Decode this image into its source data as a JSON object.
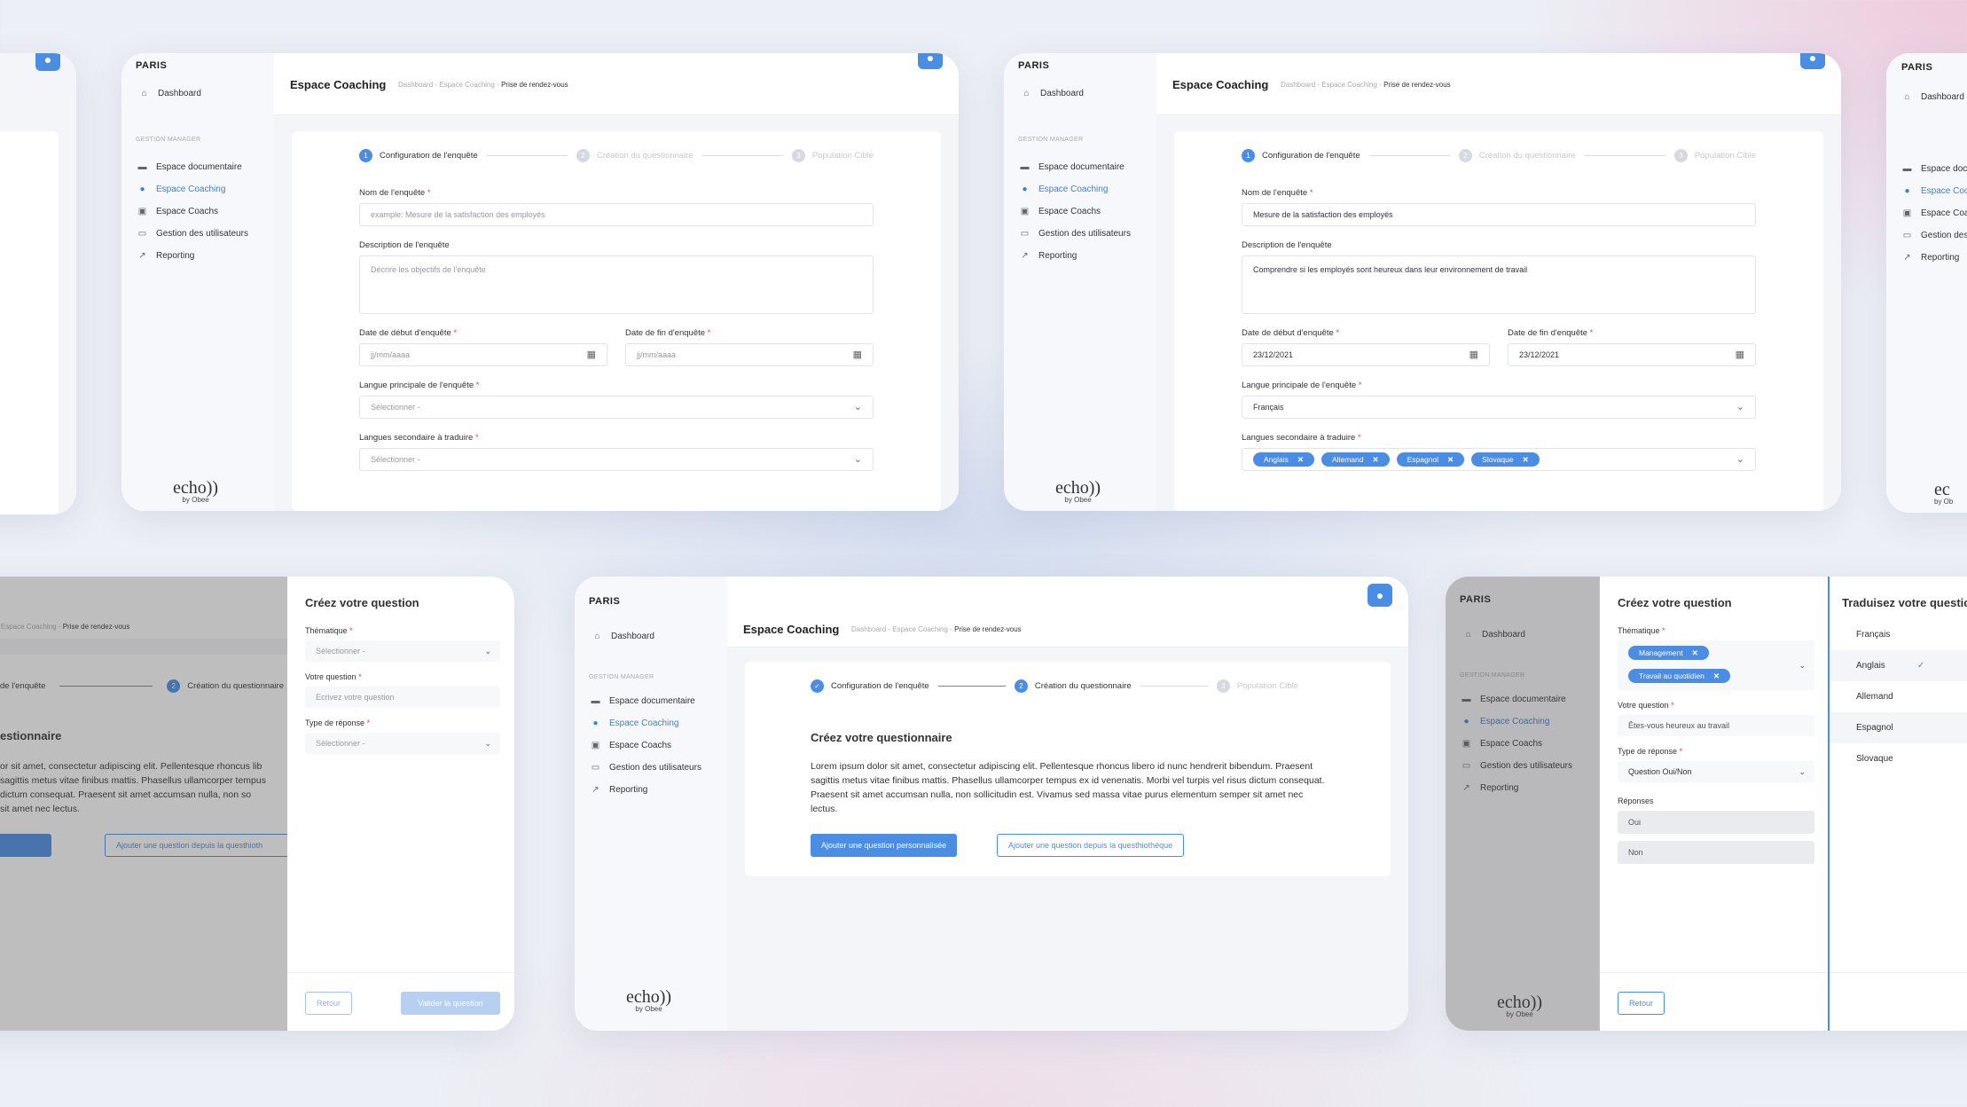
{
  "app": {
    "city_logo": "PARIS",
    "brand": "echo",
    "brand_sub": "by Obee",
    "dashboard": "Dashboard",
    "section_heading": "GESTION MANAGER",
    "nav": [
      "Espace documentaire",
      "Espace Coaching",
      "Espace Coachs",
      "Gestion des utilisateurs",
      "Reporting"
    ],
    "page_title": "Espace Coaching",
    "breadcrumb_base": "Dashboard - Espace Coaching -",
    "breadcrumb_current": "Prise de rendez-vous"
  },
  "steps": [
    "Configuration de l'enquête",
    "Création du questionnaire",
    "Population Cible"
  ],
  "survey_form": {
    "name_label": "Nom de l'enquête",
    "name_placeholder": "example: Mesure de la satisfaction des employés",
    "name_value": "Mesure de la satisfaction des employés",
    "desc_label": "Description de l'enquête",
    "desc_placeholder": "Décrire les objectifs de l'enquête",
    "desc_value": "Comprendre si les employés sont heureux dans leur environnement de travail",
    "start_label": "Date de début d'enquête",
    "end_label": "Date de fin d'enquête",
    "date_placeholder": "jj/mm/aaaa",
    "start_value": "23/12/2021",
    "end_value": "23/12/2021",
    "lang_label": "Langue principale de l'enquête",
    "select_placeholder": "Sélectionner -",
    "lang_value": "Français",
    "secondary_label": "Langues secondaire à traduire",
    "secondary_tags": [
      "Anglais",
      "Allemand",
      "Espagnol",
      "Slovaque"
    ]
  },
  "questionnaire": {
    "heading": "Créez votre questionnaire",
    "body": "Lorem ipsum dolor sit amet, consectetur adipiscing elit. Pellentesque rhoncus libero id nunc hendrerit bibendum. Praesent sagittis metus vitae finibus mattis. Phasellus ullamcorper tempus ex id venenatis. Morbi vel turpis vel risus dictum consequat. Praesent sit amet accumsan nulla, non sollicitudin est. Vivamus sed massa vitae purus elementum semper sit amet nec lectus.",
    "add_custom": "Ajouter une question personnalisée",
    "add_library": "Ajouter une question depuis la questhiothèque"
  },
  "left_partial": {
    "step1": "de l'enquête",
    "heading": "estionnaire",
    "lines": [
      "or sit amet, consectetur adipiscing elit. Pellentesque rhoncus lib",
      "sagittis metus vitae finibus mattis. Phasellus ullamcorper tempus",
      "dictum consequat. Praesent sit amet accumsan nulla, non so",
      "sit amet nec lectus."
    ],
    "btn_custom": "tion personnalisée",
    "btn_library": "Ajouter une question depuis la questhioth",
    "crumb": "l - Espace Coaching -"
  },
  "create_question": {
    "title": "Créez votre question",
    "theme_label": "Thématique",
    "question_label": "Votre question",
    "question_placeholder": "Ecrivez votre question",
    "question_value": "Êtes-vous heureux au travail",
    "type_label": "Type de réponse",
    "type_value": "Question Oui/Non",
    "theme_tags": [
      "Management",
      "Travail au quotidien"
    ],
    "answers_label": "Réponses",
    "answers": [
      "Oui",
      "Non"
    ],
    "back": "Retour",
    "validate": "Valider la question"
  },
  "translate": {
    "title": "Traduisez votre questio",
    "languages": [
      "Français",
      "Anglais",
      "Allemand",
      "Espagnol",
      "Slovaque"
    ]
  },
  "right_edge": {
    "nav": [
      "Espace doc",
      "Espace Coc",
      "Espace Coa",
      "Gestion des",
      "Reporting"
    ],
    "brand": "ec",
    "brand_sub": "by Ob"
  }
}
